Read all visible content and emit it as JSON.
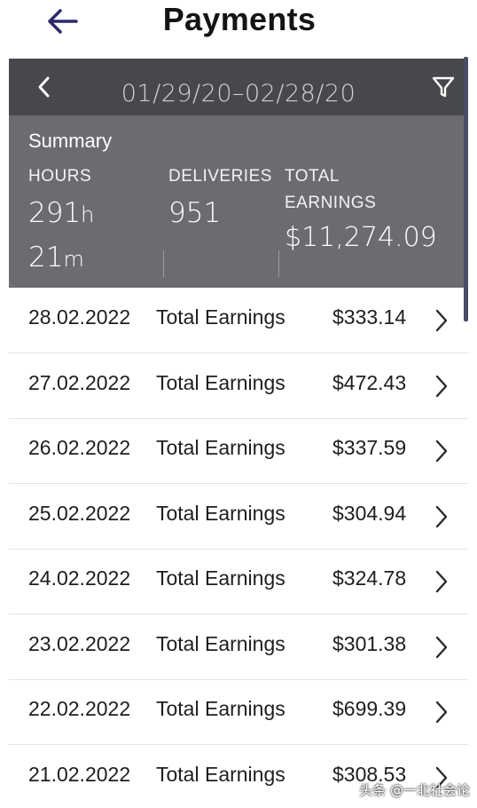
{
  "header": {
    "title": "Payments",
    "back_icon": "arrow-left-icon",
    "accent": "#2d2a6b"
  },
  "range": {
    "prev_icon": "chevron-left-icon",
    "dates": "01/29/20–02/28/20",
    "filter_icon": "filter-icon",
    "bar_color": "#46484c"
  },
  "summary": {
    "title": "Summary",
    "hours_label": "HOURS",
    "hours_value": "291",
    "hours_unit": "h",
    "minutes_value": "21",
    "minutes_unit": "m",
    "deliveries_label": "DELIVERIES",
    "deliveries_value": "951",
    "earnings_label_1": "TOTAL",
    "earnings_label_2": "EARNINGS",
    "earnings_value": "$11,274.09",
    "panel_color": "#6b6c70"
  },
  "rows": [
    {
      "date": "28.02.2022",
      "label": "Total Earnings",
      "amount": "$333.14"
    },
    {
      "date": "27.02.2022",
      "label": "Total Earnings",
      "amount": "$472.43"
    },
    {
      "date": "26.02.2022",
      "label": "Total Earnings",
      "amount": "$337.59"
    },
    {
      "date": "25.02.2022",
      "label": "Total Earnings",
      "amount": "$304.94"
    },
    {
      "date": "24.02.2022",
      "label": "Total Earnings",
      "amount": "$324.78"
    },
    {
      "date": "23.02.2022",
      "label": "Total Earnings",
      "amount": "$301.38"
    },
    {
      "date": "22.02.2022",
      "label": "Total Earnings",
      "amount": "$699.39"
    },
    {
      "date": "21.02.2022",
      "label": "Total Earnings",
      "amount": "$308.53"
    }
  ],
  "row_chevron_icon": "chevron-right-icon",
  "watermark": "头条 @一北社会论"
}
